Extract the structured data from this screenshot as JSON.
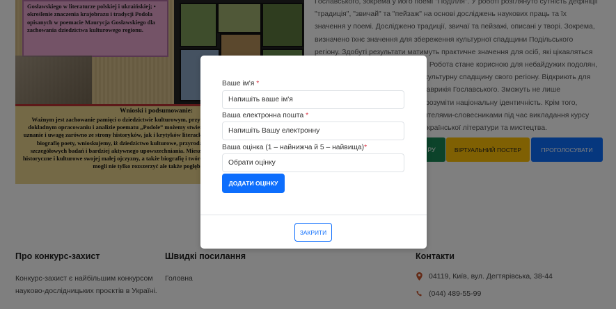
{
  "poster": {
    "pink_text": "Gosławskiego w literaturze polskiej i ukraińskiej; • określenie znaczenia krajobrazu i tradycji Podola opisanych w poemacie Maurycja Gosławskiego dla zachowania dziedzictwa kulturowego regionu.",
    "conclusion_title": "Wnioski i podsumowanie:",
    "conclusion_text": "Ważnym jest zachowanie pamięci o dziedzictwie kulturowym, przyrodzie i tradycjach Podola. Dzięki dokładnym opracowaniu i analizie poematu „Podole” możemy stwierdzić, że zasługuje on na szczególne uznanie i uwagę zarówno ze strony historyków, jak i krytyków literackich. Opracowanie pozwoliło poznać i biografię poety, wnioskujemy, iż dziedzictwo kulturowe, przyroda i krajobraz regionu wymagają szczegółowych badań i bardziej aktywnego upowszechniania. Mieszkańcy powinni dbać o dziedzictwo historyczne i kulturowe swojej małej ojczyzny, a także biografię i twórczość Maurycego Gosławskiego, będą mogli nie tylko rozszerzyć ale także pogłębić wiedzę."
  },
  "description": "Гославського, зокрема у його поемі \"Поділля\". У роботі розглянуто сутність дефініції \"традиція\", \"звичай\" та \"пейзаж\" на основі досліджень наукових праць та їх значення у поемі. Досліджено традиції, звичаї та пейзажі, описані у творі. Зокрема, визначено їхнє значення для збереження культурної спадщини Подільського регіону. Здобуті результати матимуть практичне значення для осіб, які цікавляться традиціями та звичаями Поділля. Робота стане корисною для небайдужих подолян, які хочуть поглибити знання про культурну спадщину свого регіону. Відкриють для себе сторінки життя і творчості Маврикія Гославського. Зможуть не лише розширити кругозір, а й глибше зрозуміти національну ідентичність. Крім того, матеріали будуть використані вчителями-словесниками під час викладання курсу «Українська мова і література», української літератури та мистецтва.",
  "buttons": {
    "green": "РУ",
    "poster": "ВІРТУАЛЬНИЙ ПОСТЕР",
    "vote": "ПРОГОЛОСУВАТИ"
  },
  "footer": {
    "about_title": "Про конкурс-захист",
    "about_text": "Конкурс-захист є найбільшим конкурсом науково-дослідницьких проєктів в Україні.",
    "links_title": "Швидкі посилання",
    "links": [
      "Головна"
    ],
    "contacts_title": "Контакти",
    "address": "04119, Київ, вул. Дегтярівська, 38-44",
    "phone": "(044) 489-55-99"
  },
  "modal": {
    "name_label": "Ваше ім'я",
    "name_placeholder": "Напишіть ваше ім'я",
    "email_label": "Ваша електронна пошта",
    "email_placeholder": "Напишіть Вашу електронну",
    "rating_label": "Ваша оцінка (1 – найнижча й 5 – найвища)",
    "rating_value": "Обрати оцінку",
    "required_mark": "*",
    "add_button": "ДОДАТИ ОЦІНКУ",
    "close_button": "ЗАКРИТИ"
  },
  "colors": {
    "primary": "#0d6efd",
    "success": "#198754",
    "warning": "#ffc107",
    "danger": "#dc3545"
  }
}
